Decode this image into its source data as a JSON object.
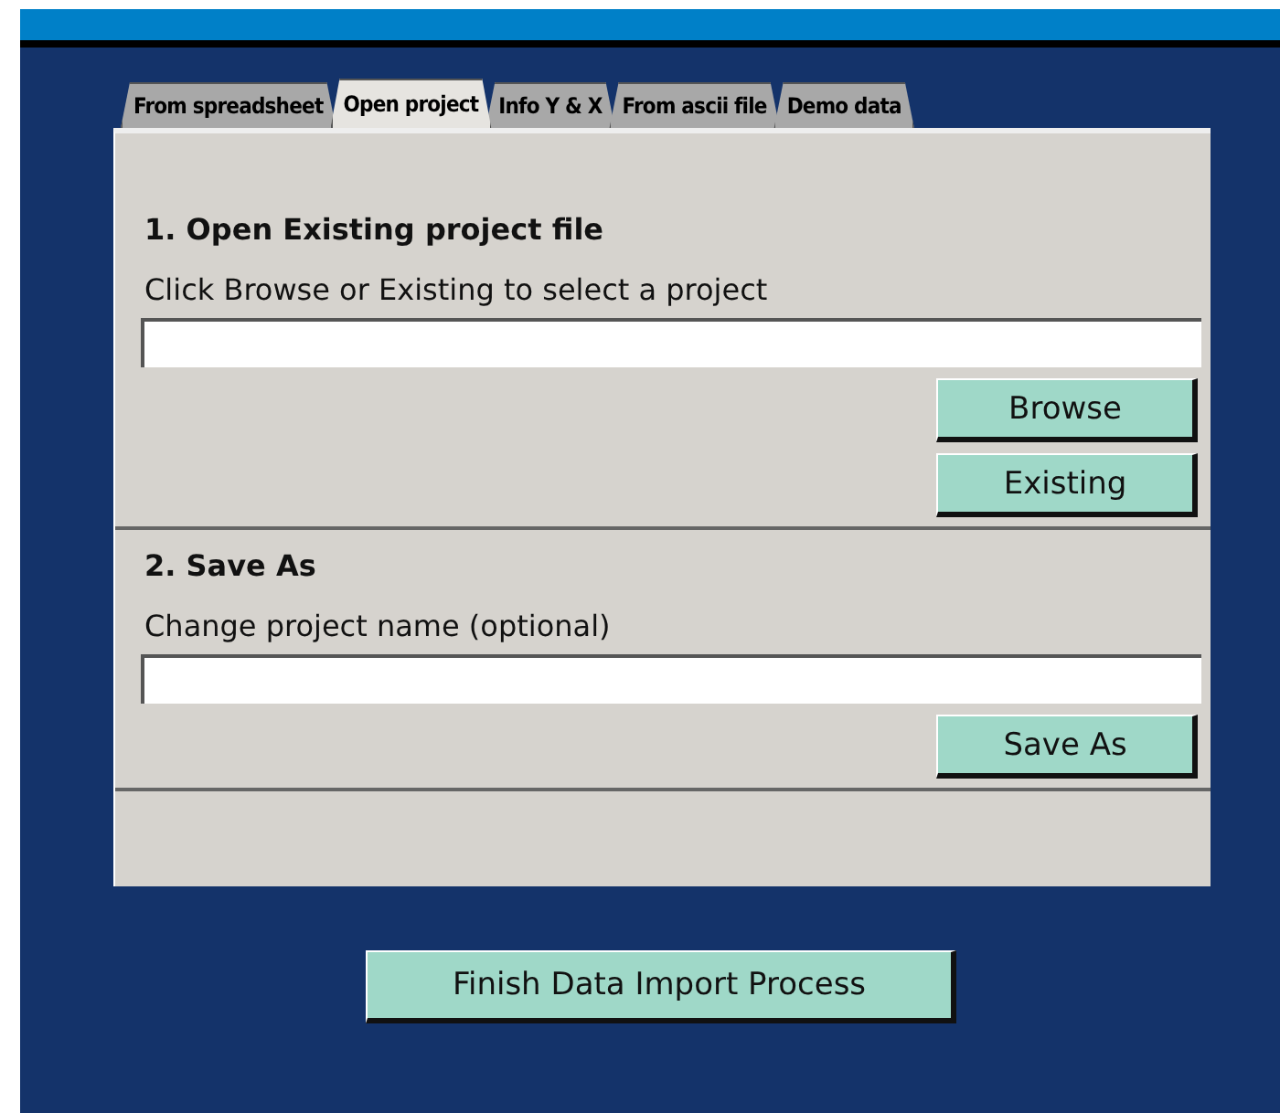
{
  "tabs": [
    {
      "label": "From spreadsheet",
      "selected": false
    },
    {
      "label": "Open project",
      "selected": true
    },
    {
      "label": "Info Y & X",
      "selected": false
    },
    {
      "label": "From ascii file",
      "selected": false
    },
    {
      "label": "Demo data",
      "selected": false
    }
  ],
  "sections": [
    {
      "title": "1. Open Existing project file",
      "hint": "Click Browse or Existing to select a project",
      "buttons": [
        "Browse",
        "Existing"
      ]
    },
    {
      "title": "2. Save As",
      "hint": "Change project name (optional)",
      "buttons": [
        "Save As"
      ]
    }
  ],
  "finish_button": "Finish Data Import Process"
}
